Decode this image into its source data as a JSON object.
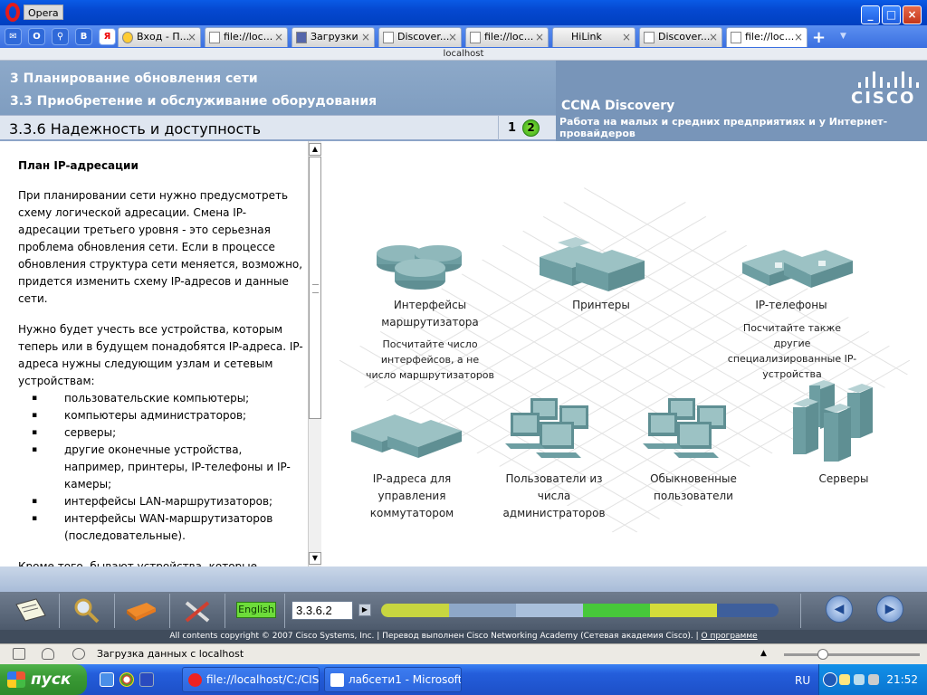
{
  "browser": {
    "app_title": "Opera",
    "address": "localhost",
    "tabs": [
      {
        "label": "Вход - П...",
        "active": false
      },
      {
        "label": "file://loc...",
        "active": false
      },
      {
        "label": "Загрузки",
        "active": false
      },
      {
        "label": "Discover...",
        "active": false
      },
      {
        "label": "file://loc...",
        "active": false
      },
      {
        "label": "HiLink",
        "active": false
      },
      {
        "label": "Discover...",
        "active": false
      },
      {
        "label": "file://loc...",
        "active": true
      }
    ],
    "quick_icons": [
      "mail-icon",
      "opera-icon",
      "search-icon",
      "vk-icon",
      "yandex-icon"
    ]
  },
  "header": {
    "line1": "3 Планирование обновления сети",
    "line2": "3.3 Приобретение и обслуживание оборудования",
    "course": "CCNA Discovery",
    "course_subtitle": "Работа на малых и средних предприятиях и у Интернет-провайдеров",
    "logo": "CISCO"
  },
  "pagebar": {
    "title": "3.3.6 Надежность и доступность",
    "page1": "1",
    "page2": "2"
  },
  "text": {
    "heading": "План IP-адресации",
    "p1": "При планировании сети нужно предусмотреть схему логической адресации. Смена IP-адресации третьего уровня - это серьезная проблема обновления сети. Если в процессе обновления структура сети меняется, возможно, придется изменить схему IP-адресов и данные сети.",
    "p2": "Нужно будет учесть все устройства, которым теперь или в будущем понадобятся IP-адреса. IP-адреса нужны следующим узлам и сетевым устройствам:",
    "bullets": [
      "пользовательские компьютеры;",
      "компьютеры администраторов;",
      "серверы;",
      "другие оконечные устройства, например, принтеры, IP-телефоны и IP-камеры;",
      "интерфейсы LAN-маршрутизаторов;",
      "интерфейсы WAN-маршрутизаторов (последовательные)."
    ],
    "p3": "Кроме того, бывают устройства, которые открываются и управляются с использованием IP-адресов. К этой категории относятся:"
  },
  "graphic": {
    "items": [
      {
        "label": "Интерфейсы маршрутизатора",
        "note": "Посчитайте число интерфейсов, а не число маршрутизаторов"
      },
      {
        "label": "Принтеры",
        "note": ""
      },
      {
        "label": "IP-телефоны",
        "note": "Посчитайте также другие специализированные IP-устройства"
      },
      {
        "label": "IP-адреса для управления коммутатором",
        "note": ""
      },
      {
        "label": "Пользователи из числа администраторов",
        "note": ""
      },
      {
        "label": "Обыкновенные пользователи",
        "note": ""
      },
      {
        "label": "Серверы",
        "note": ""
      }
    ]
  },
  "toolbar": {
    "language": "English",
    "page_value": "3.3.6.2",
    "progress_colors": [
      "#c8d640",
      "#8ea8c8",
      "#a9c0dc",
      "#47c83a",
      "#d4dc3a",
      "#3e5f9c"
    ]
  },
  "footer": {
    "copyright": "All contents copyright © 2007 Cisco Systems, Inc. | Перевод выполнен Cisco Networking Academy (Сетевая академия Cisco). |",
    "about_link": "О программе"
  },
  "status": {
    "text": "Загрузка данных с localhost"
  },
  "taskbar": {
    "start": "пуск",
    "items": [
      "file://localhost/C:/CIS...",
      "лабсети1 - Microsoft ..."
    ],
    "language": "RU",
    "clock": "21:52"
  }
}
